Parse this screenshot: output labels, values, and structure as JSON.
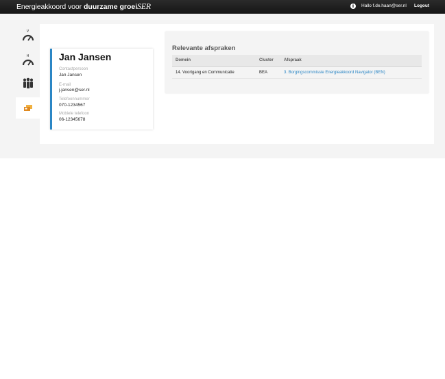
{
  "header": {
    "brand_light": "Energieakkoord voor",
    "brand_bold": "duurzame groei",
    "brand_ser": "SER",
    "info_glyph": "i",
    "greeting": "Hallo f.de.haan@ser.nl",
    "logout_label": "Logout"
  },
  "sidebar": {
    "items": [
      {
        "name": "dashboard-v",
        "letter": "V",
        "icon": "gauge-icon"
      },
      {
        "name": "dashboard-h",
        "letter": "H",
        "icon": "gauge-icon"
      },
      {
        "name": "contacts",
        "letter": "",
        "icon": "people-icon"
      },
      {
        "name": "agreements",
        "letter": "",
        "icon": "cards-icon",
        "active": true
      }
    ]
  },
  "contact": {
    "name": "Jan Jansen",
    "contactperson_label": "Contactpersoon",
    "contactperson_value": "Jan Jansen",
    "email_label": "E-mail",
    "email_value": "j.jansen@ser.nl",
    "phone_label": "Telefoonnummer",
    "phone_value": "070-1234567",
    "mobile_label": "Mobiele telefoon",
    "mobile_value": "06-12345678"
  },
  "afspraken": {
    "title": "Relevante afspraken",
    "columns": [
      "Domein",
      "Cluster",
      "Afspraak"
    ],
    "rows": [
      {
        "domein": "14. Voortgang en Communicatie",
        "cluster": "BEA",
        "afspraak": "3. Borgingscommissie Energieakkoord Navigator (BEN)"
      }
    ]
  },
  "colors": {
    "accent": "#2b86c5",
    "topbar": "#1d1d1d",
    "icon_active": "#e8a030"
  }
}
